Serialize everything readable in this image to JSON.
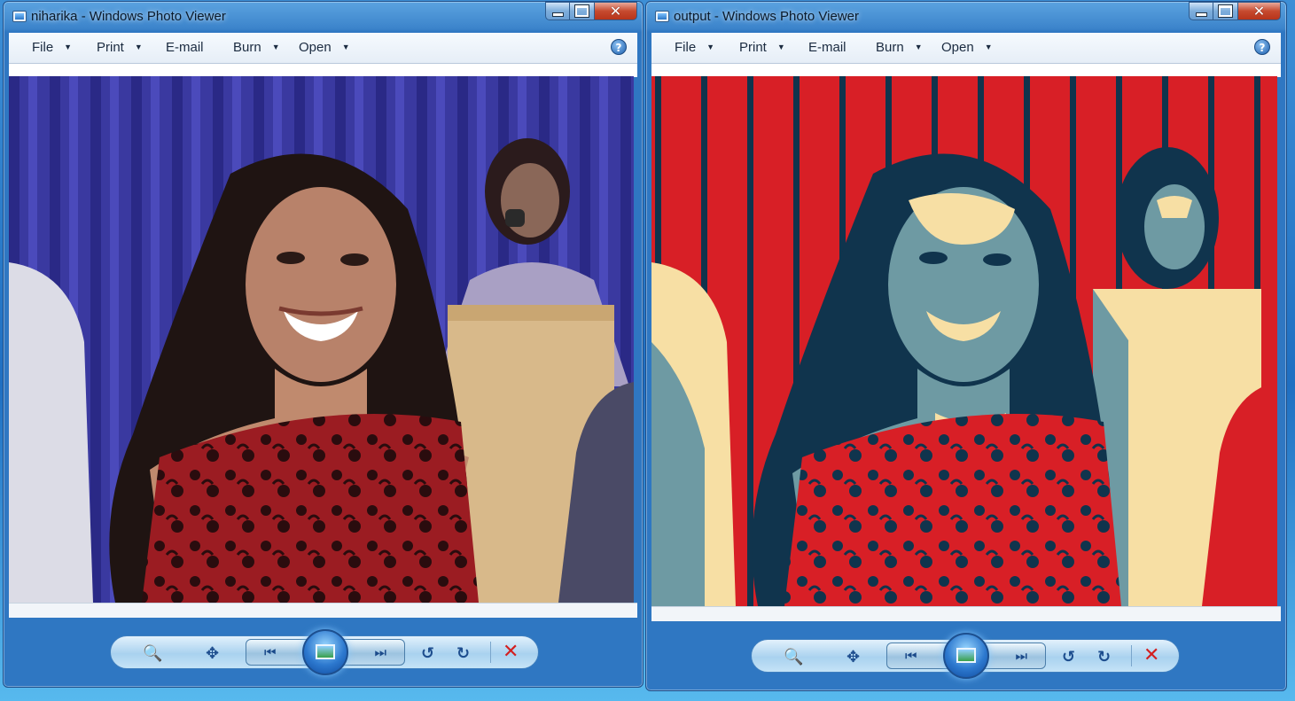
{
  "windows": [
    {
      "title": "niharika - Windows Photo Viewer",
      "menu": [
        "File",
        "Print",
        "E-mail",
        "Burn",
        "Open"
      ],
      "photo": "original-photo"
    },
    {
      "title": "output - Windows Photo Viewer",
      "menu": [
        "File",
        "Print",
        "E-mail",
        "Burn",
        "Open"
      ],
      "photo": "posterized-photo"
    }
  ],
  "icons": {
    "help": "?",
    "close": "✕",
    "zoom": "🔍",
    "fit": "✥",
    "previous": "⏮",
    "next": "⏭",
    "rotate_ccw": "↺",
    "rotate_cw": "↻",
    "delete": "✕"
  },
  "colors": {
    "poster_red": "#d81f26",
    "poster_navy": "#10344d",
    "poster_teal": "#6e9aa3",
    "poster_cream": "#f7dfa4",
    "curtain_blue": "#3b3a9e",
    "dress_red": "#9e1f26"
  }
}
